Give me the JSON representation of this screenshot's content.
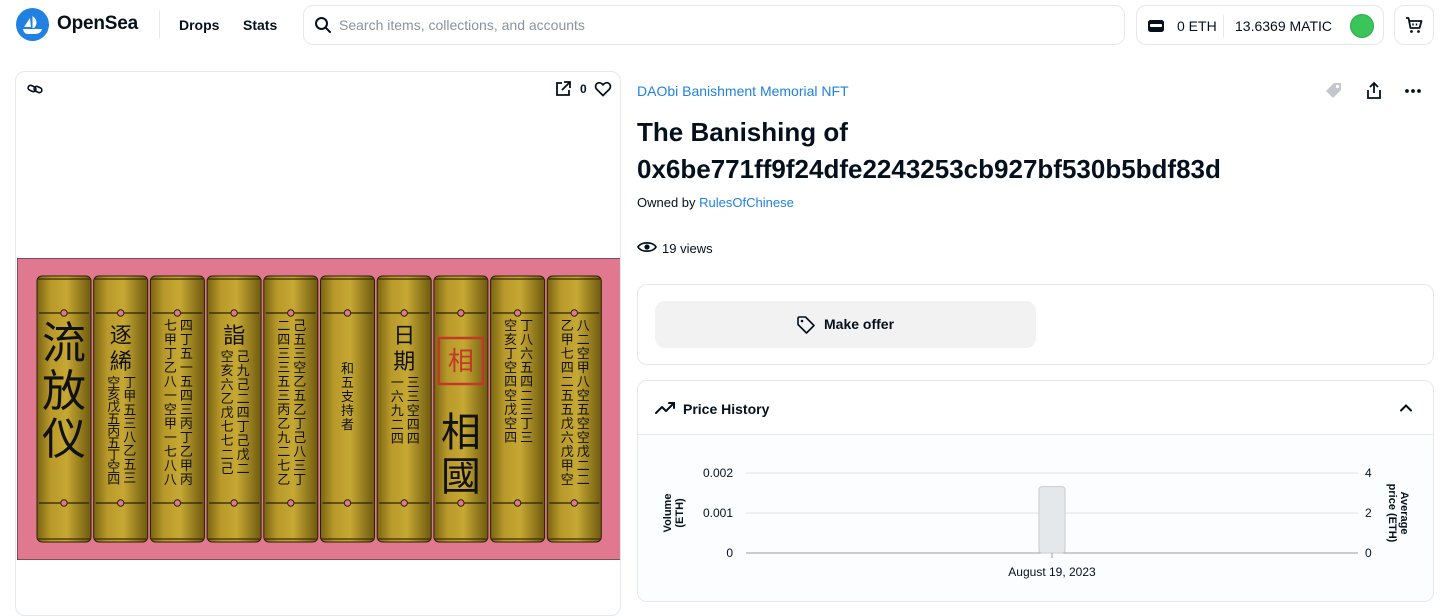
{
  "brand": {
    "name": "OpenSea"
  },
  "nav": {
    "drops": "Drops",
    "stats": "Stats"
  },
  "search": {
    "placeholder": "Search items, collections, and accounts",
    "value": ""
  },
  "wallet": {
    "eth": "0 ETH",
    "matic": "13.6369 MATIC"
  },
  "image_card": {
    "favorites": "0"
  },
  "nft_art": {
    "background": "#e07890",
    "scroll_color": "#b89b25",
    "columns": [
      {
        "big": [
          "流",
          "放",
          "仪"
        ],
        "small": []
      },
      {
        "big": [
          "逐",
          "絺"
        ],
        "small": [
          "丁甲五三八乙五三",
          "空亥戊五丙五丁空四"
        ]
      },
      {
        "big": [],
        "small": [
          "四丁五一五四三丙丁乙甲丙",
          "七甲丁乙八一空甲一七八八"
        ]
      },
      {
        "big": [
          "詣"
        ],
        "small": [
          "己九己二四丁己戊二",
          "空亥六乙戊七七二己"
        ]
      },
      {
        "big": [],
        "small": [
          "己五三空乙五乙丁己八三丁",
          "二四三三五三丙乙九二七乙"
        ]
      },
      {
        "big": [],
        "small": [
          "和五支持者"
        ]
      },
      {
        "big": [
          "日",
          "期"
        ],
        "small": [
          "三三空四四",
          "一六九二四"
        ]
      },
      {
        "big": [
          "相",
          "國"
        ],
        "small": [],
        "seal": "相國"
      },
      {
        "big": [],
        "small": [
          "丁八六五四二三丁三",
          "空亥丁空四空戊空四"
        ]
      },
      {
        "big": [],
        "small": [
          "八二空甲八空五空空戊二二",
          "乙甲七四二五五戊六戊甲空"
        ]
      }
    ]
  },
  "item": {
    "collection": "DAObi Banishment Memorial NFT",
    "title_line1": "The Banishing of",
    "title_line2": "0x6be771ff9f24dfe2243253cb927bf530b5bdf83d",
    "owned_by_label": "Owned by",
    "owner": "RulesOfChinese",
    "views": "19 views"
  },
  "offer": {
    "label": "Make offer"
  },
  "price_history": {
    "title": "Price History"
  },
  "chart_data": {
    "type": "bar",
    "categories": [
      "August 19, 2023"
    ],
    "series": [
      {
        "name": "Volume (ETH)",
        "values": [
          0.00166
        ]
      }
    ],
    "ylabel": "Volume\n(ETH)",
    "y2label": "Average\nprice (ETH)",
    "ylim": [
      0,
      0.002
    ],
    "y2lim": [
      0,
      4
    ],
    "yticks": [
      "0",
      "0.001",
      "0.002"
    ],
    "y2ticks": [
      "0",
      "2",
      "4"
    ],
    "grid": true
  },
  "colors": {
    "accent": "#2081e2",
    "text": "#04111d",
    "border": "#e5e8eb"
  }
}
